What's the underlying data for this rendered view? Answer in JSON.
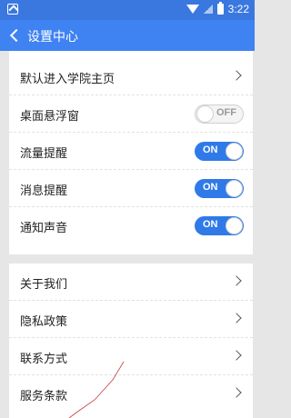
{
  "status": {
    "time": "3:22",
    "icons": [
      "notification-icon",
      "wifi-icon",
      "signal-icon",
      "battery-icon"
    ]
  },
  "header": {
    "title": "设置中心",
    "back_icon": "chevron-left-icon"
  },
  "section1": {
    "items": [
      {
        "label": "默认进入学院主页",
        "type": "link"
      },
      {
        "label": "桌面悬浮窗",
        "type": "toggle",
        "state": "OFF"
      },
      {
        "label": "流量提醒",
        "type": "toggle",
        "state": "ON"
      },
      {
        "label": "消息提醒",
        "type": "toggle",
        "state": "ON"
      },
      {
        "label": "通知声音",
        "type": "toggle",
        "state": "ON"
      }
    ]
  },
  "section2": {
    "items": [
      {
        "label": "关于我们"
      },
      {
        "label": "隐私政策"
      },
      {
        "label": "联系方式"
      },
      {
        "label": "服务条款"
      }
    ]
  },
  "colors": {
    "status_bar": "#3a78e0",
    "title_bar": "#3f82f2",
    "toggle_on": "#2f7ae8",
    "background": "#e6e6e6"
  }
}
